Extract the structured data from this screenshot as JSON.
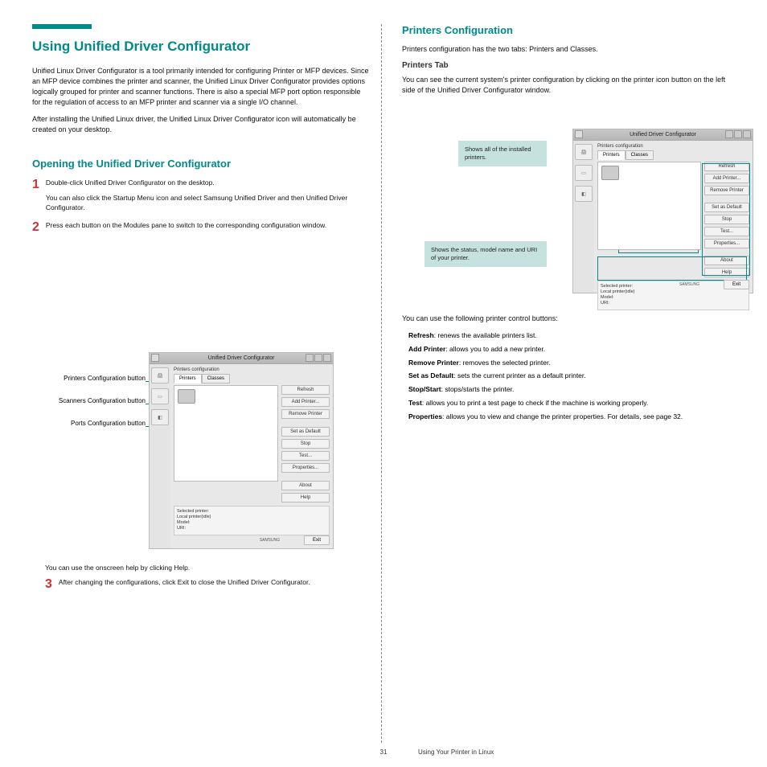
{
  "left": {
    "section_title": "Using Unified Driver Configurator",
    "p1": "Unified Linux Driver Configurator is a tool primarily intended for configuring Printer or MFP devices. Since an MFP device combines the printer and scanner, the Unified Linux Driver Configurator provides options logically grouped for printer and scanner functions. There is also a special MFP port option responsible for the regulation of access to an MFP printer and scanner via a single I/O channel.",
    "p2": "After installing the Unified Linux driver, the Unified Linux Driver Configurator icon will automatically be created on your desktop.",
    "sub_title": "Opening the Unified Driver Configurator",
    "step1_no": "1",
    "step1": "Double-click Unified Driver Configurator on the desktop.",
    "step1b": "You can also click the Startup Menu icon and select Samsung Unified Driver and then Unified Driver Configurator.",
    "step2_no": "2",
    "step2": "Press each button on the Modules pane to switch to the corresponding configuration window.",
    "annot_printers": "Printers Configuration button",
    "annot_scanners": "Scanners Configuration button",
    "annot_ports": "Ports Configuration button",
    "tip": "You can use the onscreen help by clicking Help.",
    "step3_no": "3",
    "step3": "After changing the configurations, click Exit to close the Unified Driver Configurator."
  },
  "right": {
    "sub_title": "Printers Configuration",
    "p1": "Printers configuration has the two tabs: Printers and Classes.",
    "h_ptab": "Printers Tab",
    "p2": "You can see the current system's printer configuration by clicking on the printer icon button on the left side of the Unified Driver Configurator window.",
    "callout1": "Shows all of the installed printers.",
    "callout2": "Shows the status, model name and URI of your printer.",
    "intro_btns": "You can use the following printer control buttons:",
    "btns": [
      {
        "lbl": "Refresh",
        "desc": ": renews the available printers list."
      },
      {
        "lbl": "Add Printer",
        "desc": ": allows you to add a new printer."
      },
      {
        "lbl": "Remove Printer",
        "desc": ": removes the selected printer."
      },
      {
        "lbl": "Set as Default",
        "desc": ": sets the current printer as a default printer."
      },
      {
        "lbl": "Stop/Start",
        "desc": ": stops/starts the printer."
      },
      {
        "lbl": "Test",
        "desc": ": allows you to print a test page to check if the machine is working properly."
      },
      {
        "lbl": "Properties",
        "desc": ": allows you to view and change the printer properties. For details, see page 32."
      }
    ]
  },
  "screenshot": {
    "title": "Unified Driver Configurator",
    "panel_label": "Printers configuration",
    "tabs": {
      "printers": "Printers",
      "classes": "Classes"
    },
    "buttons": {
      "refresh": "Refresh",
      "add": "Add Printer...",
      "remove": "Remove Printer",
      "setdef": "Set as Default",
      "stop": "Stop",
      "test": "Test...",
      "props": "Properties...",
      "about": "About",
      "help": "Help"
    },
    "info_title": "Selected printer:",
    "info_line1": "Local printer(idle)",
    "info_line2": "Model:",
    "info_line3": "URI:",
    "logo": "SAMSUNG",
    "exit": "Exit"
  },
  "footer": {
    "page": "31",
    "title": "Using Your Printer in Linux"
  }
}
